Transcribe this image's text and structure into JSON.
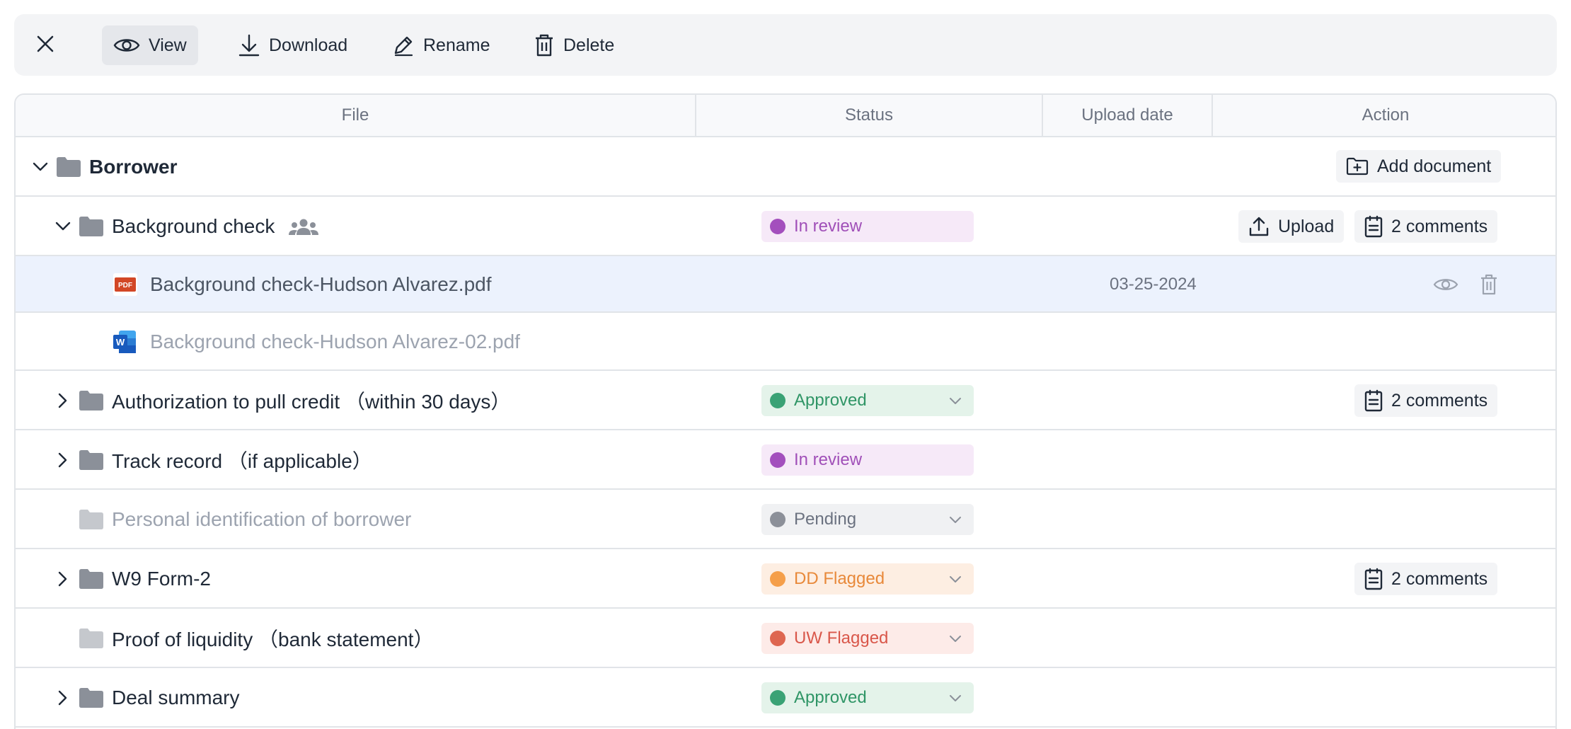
{
  "toolbar": {
    "view_label": "View",
    "download_label": "Download",
    "rename_label": "Rename",
    "delete_label": "Delete"
  },
  "table": {
    "columns": [
      "File",
      "Status",
      "Upload date",
      "Action"
    ]
  },
  "group": {
    "name": "Borrower",
    "add_document_label": "Add document"
  },
  "rows": [
    {
      "name": "Background check",
      "status": "In review",
      "upload_label": "Upload",
      "comments_label": "2 comments"
    },
    {
      "name": "Background check-Hudson Alvarez.pdf",
      "file_type": "PDF",
      "upload_date": "03-25-2024"
    },
    {
      "name": "Background check-Hudson Alvarez-02.pdf",
      "file_type": "W"
    },
    {
      "name": "Authorization to pull credit （within 30 days）",
      "status": "Approved",
      "comments_label": "2 comments"
    },
    {
      "name": "Track record （if applicable）",
      "status": "In review"
    },
    {
      "name": "Personal identification of borrower",
      "status": "Pending"
    },
    {
      "name": "W9 Form-2",
      "status": "DD Flagged",
      "comments_label": "2 comments"
    },
    {
      "name": "Proof of liquidity （bank statement）",
      "status": "UW Flagged"
    },
    {
      "name": "Deal summary",
      "status": "Approved"
    }
  ],
  "colors": {
    "in_review_bg": "#f6e9f8",
    "in_review_fg": "#a04fb8",
    "in_review_dot": "#a34fbd",
    "approved_bg": "#e4f3ea",
    "approved_fg": "#2f9566",
    "approved_dot": "#3aa275",
    "pending_bg": "#f0f1f3",
    "pending_fg": "#6b7280",
    "pending_dot": "#8c9099",
    "dd_bg": "#fdeee2",
    "dd_fg": "#e8893a",
    "dd_dot": "#f59f4a",
    "uw_bg": "#fdebe8",
    "uw_fg": "#d9574a",
    "uw_dot": "#de6650",
    "folder": "#8b9099",
    "folder_light": "#c5c8cd",
    "selected_row": "#ecf2fd"
  }
}
